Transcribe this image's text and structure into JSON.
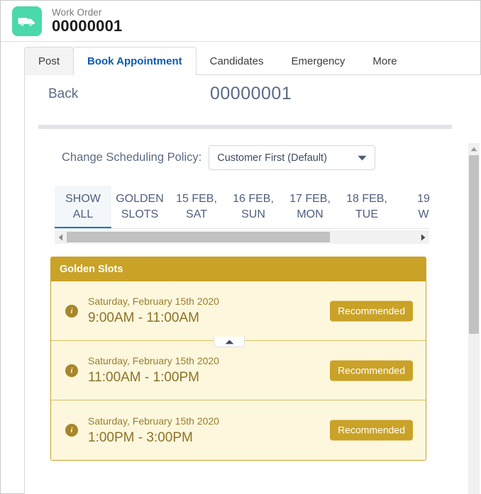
{
  "record_header": {
    "icon_name": "truck-icon",
    "object_label": "Work Order",
    "record_number": "00000001"
  },
  "tabs": [
    {
      "label": "Post",
      "active": false
    },
    {
      "label": "Book Appointment",
      "active": true
    },
    {
      "label": "Candidates",
      "active": false
    },
    {
      "label": "Emergency",
      "active": false
    },
    {
      "label": "More",
      "active": false
    }
  ],
  "nav": {
    "back_label": "Back",
    "page_title": "00000001"
  },
  "policy": {
    "label": "Change Scheduling Policy:",
    "selected": "Customer First (Default)",
    "caret_icon": "chevron-down-icon"
  },
  "date_tabs": [
    {
      "line1": "SHOW",
      "line2": "ALL",
      "active": true
    },
    {
      "line1": "GOLDEN",
      "line2": "SLOTS",
      "active": false
    },
    {
      "line1": "15 FEB,",
      "line2": "SAT",
      "active": false
    },
    {
      "line1": "16 FEB,",
      "line2": "SUN",
      "active": false
    },
    {
      "line1": "17 FEB,",
      "line2": "MON",
      "active": false
    },
    {
      "line1": "18 FEB,",
      "line2": "TUE",
      "active": false
    },
    {
      "line1": "19",
      "line2": "W",
      "active": false
    }
  ],
  "hscroll": {
    "left_arrow_icon": "chevron-left-icon",
    "right_arrow_icon": "chevron-right-icon"
  },
  "collapse_button": {
    "icon": "chevron-up-icon"
  },
  "slots_panel": {
    "header": "Golden Slots",
    "accent_color": "#c9a227",
    "row_background": "#fdf7dd",
    "rows": [
      {
        "info_icon": "info-icon",
        "date": "Saturday, February 15th 2020",
        "time": "9:00AM - 11:00AM",
        "badge": "Recommended"
      },
      {
        "info_icon": "info-icon",
        "date": "Saturday, February 15th 2020",
        "time": "11:00AM - 1:00PM",
        "badge": "Recommended"
      },
      {
        "info_icon": "info-icon",
        "date": "Saturday, February 15th 2020",
        "time": "1:00PM - 3:00PM",
        "badge": "Recommended"
      }
    ]
  },
  "vscroll": {
    "up_arrow_icon": "chevron-up-icon"
  }
}
